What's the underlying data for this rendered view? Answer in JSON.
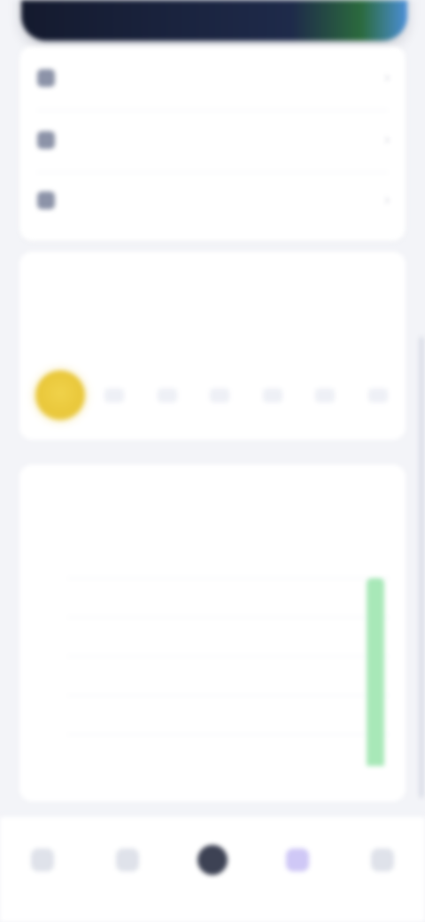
{
  "header": {
    "accent_colors": [
      "#141a2e",
      "#1e2a4a",
      "#2b6a3d",
      "#4b8fd8"
    ]
  },
  "menu": {
    "items": [
      {
        "label": "",
        "icon": "document-icon"
      },
      {
        "label": "",
        "icon": "settings-icon"
      },
      {
        "label": "",
        "icon": "help-icon"
      }
    ]
  },
  "streak": {
    "title": "",
    "left_label": "",
    "right_label": "",
    "badge_icon": "sun-icon",
    "badge_color": "#e9c73a",
    "days": [
      "",
      "",
      "",
      "",
      "",
      ""
    ]
  },
  "activity": {
    "title": "",
    "left_label": "",
    "right_label": "",
    "x_caption": "",
    "bar_color": "#a8e8b8"
  },
  "chart_data": {
    "type": "bar",
    "categories": [
      "",
      "",
      "",
      "",
      "",
      "",
      ""
    ],
    "series": [
      {
        "values": [
          0,
          0,
          0,
          0,
          0,
          0,
          1
        ]
      }
    ],
    "title": "",
    "xlabel": "",
    "ylabel": "",
    "ytick_labels": [
      "",
      "",
      "",
      "",
      ""
    ],
    "ylim": [
      0,
      1
    ],
    "grid": true
  },
  "tabs": [
    {
      "label": "",
      "icon": "chat-icon"
    },
    {
      "label": "",
      "icon": "bell-icon"
    },
    {
      "label": "",
      "icon": "home-icon"
    },
    {
      "label": "",
      "icon": "star-icon"
    },
    {
      "label": "",
      "icon": "profile-icon"
    }
  ]
}
